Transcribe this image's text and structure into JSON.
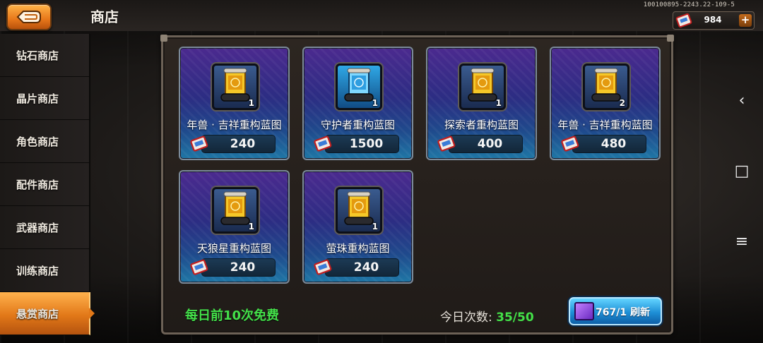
{
  "header": {
    "title": "商店",
    "build_id": "100100895-2243.22-109-5",
    "currency_value": "984",
    "currency_plus": "+"
  },
  "sidebar": {
    "items": [
      {
        "label": "钻石商店",
        "active": false
      },
      {
        "label": "晶片商店",
        "active": false
      },
      {
        "label": "角色商店",
        "active": false
      },
      {
        "label": "配件商店",
        "active": false
      },
      {
        "label": "武器商店",
        "active": false
      },
      {
        "label": "训练商店",
        "active": false
      },
      {
        "label": "悬赏商店",
        "active": true
      }
    ]
  },
  "shop": {
    "items": [
      {
        "name": "年兽 · 吉祥重构蓝图",
        "qty": "1",
        "price": "240",
        "frame": "gold"
      },
      {
        "name": "守护者重构蓝图",
        "qty": "1",
        "price": "1500",
        "frame": "blue"
      },
      {
        "name": "探索者重构蓝图",
        "qty": "1",
        "price": "400",
        "frame": "gold"
      },
      {
        "name": "年兽 · 吉祥重构蓝图",
        "qty": "2",
        "price": "480",
        "frame": "gold"
      },
      {
        "name": "天狼星重构蓝图",
        "qty": "1",
        "price": "240",
        "frame": "gold"
      },
      {
        "name": "萤珠重构蓝图",
        "qty": "1",
        "price": "240",
        "frame": "gold"
      }
    ],
    "footer_note": "每日前10次免费",
    "daily_label": "今日次数:",
    "daily_count": "35/50",
    "refresh_label": "767/1 刷新"
  },
  "system_nav": {
    "back_icon": "‹",
    "home_icon": "□",
    "menu_icon": "≡"
  },
  "colors": {
    "accent_orange": "#e27818",
    "accent_green": "#43e048",
    "card_purple": "#4b2a8f",
    "card_blue": "#1f77a6"
  }
}
